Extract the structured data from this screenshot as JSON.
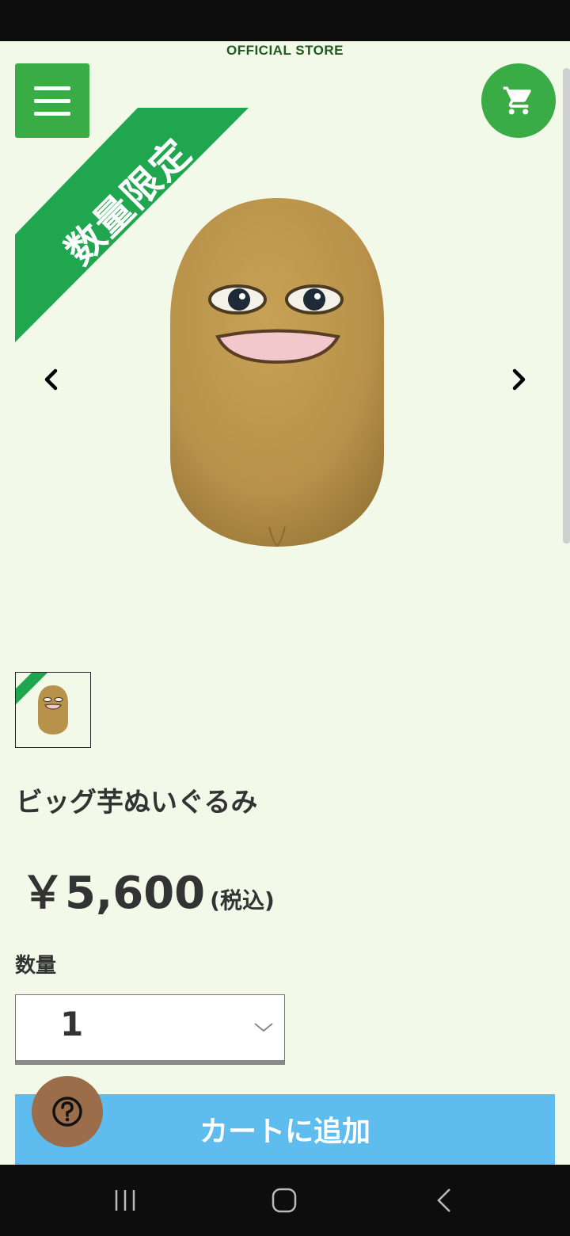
{
  "header": {
    "store_label": "OFFICIAL STORE",
    "menu_icon": "hamburger-menu-icon",
    "cart_icon": "shopping-cart-icon"
  },
  "badge": {
    "text": "数量限定",
    "color": "#21a650"
  },
  "gallery": {
    "prev_icon": "chevron-left-icon",
    "next_icon": "chevron-right-icon"
  },
  "product": {
    "title": "ビッグ芋ぬいぐるみ",
    "price": "￥5,600",
    "tax_note": "(税込)"
  },
  "quantity": {
    "label": "数量",
    "selected": "1"
  },
  "actions": {
    "add_to_cart": "カートに追加",
    "help_icon": "question-mark-icon"
  },
  "colors": {
    "page_bg": "#f3f9e8",
    "brand_green": "#3aac45",
    "cart_button_blue": "#5ebcee",
    "help_button_brown": "#9b6d4a"
  }
}
